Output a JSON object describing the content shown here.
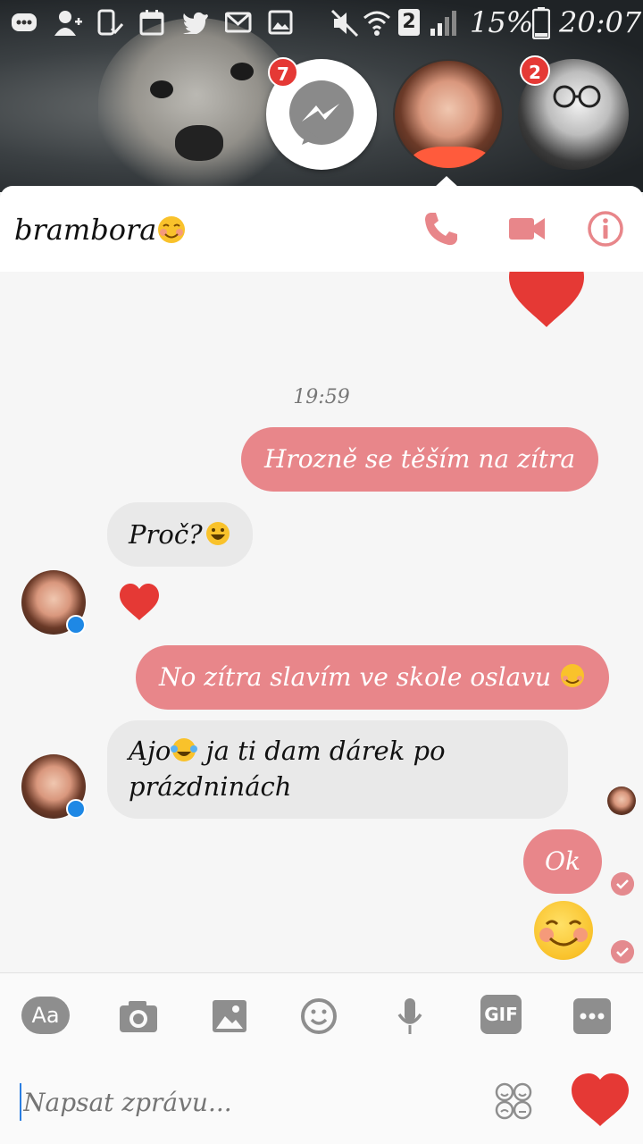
{
  "status_bar": {
    "sim_slot": "2",
    "battery_percent": "15%",
    "time": "20:07"
  },
  "chat_heads": {
    "messenger_badge": "7",
    "friend_badge": "2"
  },
  "header": {
    "contact_name": "brambora"
  },
  "messages": {
    "timestamp": "19:59",
    "m1": "Hrozně se těším na zítra",
    "m2": "Proč?",
    "m3": "No zítra slavím ve skole oslavu",
    "m4_line1": "Ajo",
    "m4_line1b": "ja ti dam dárek po",
    "m4_line2": "prázdninách",
    "m5": "Ok"
  },
  "toolbar": {
    "text_button": "Aa",
    "gif_button": "GIF"
  },
  "composer": {
    "placeholder": "Napsat zprávu..."
  },
  "colors": {
    "accent": "#e8868a",
    "incoming_bubble": "#e9e9e9",
    "heart": "#e53935"
  }
}
